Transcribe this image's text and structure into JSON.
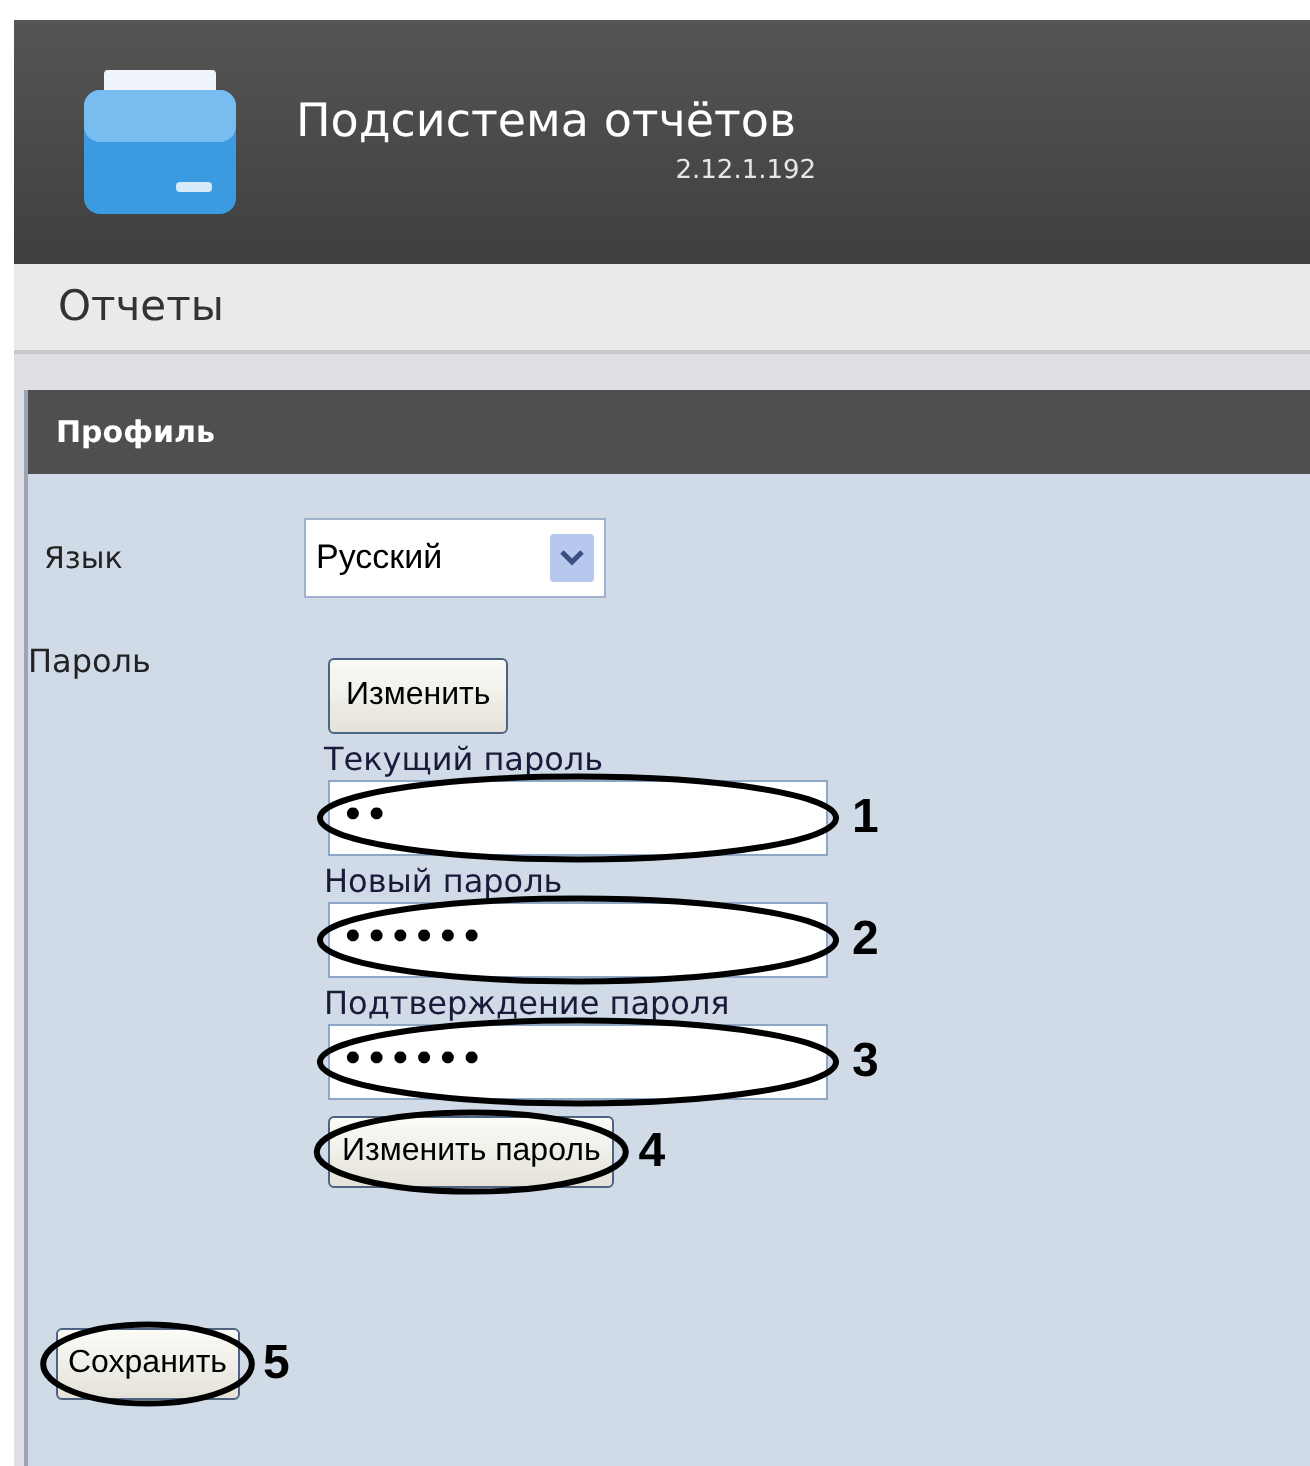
{
  "header": {
    "title": "Подсистема отчётов",
    "version": "2.12.1.192"
  },
  "nav": {
    "label": "Отчеты"
  },
  "panel": {
    "title": "Профиль",
    "language": {
      "label": "Язык",
      "value": "Русский"
    },
    "password": {
      "label": "Пароль",
      "toggle_button": "Изменить",
      "fields": [
        {
          "label": "Текущий пароль",
          "value": "••",
          "callout": "1"
        },
        {
          "label": "Новый пароль",
          "value": "••••••",
          "callout": "2"
        },
        {
          "label": "Подтверждение пароля",
          "value": "••••••",
          "callout": "3"
        }
      ],
      "submit": {
        "label": "Изменить пароль",
        "callout": "4"
      }
    },
    "save": {
      "label": "Сохранить",
      "callout": "5"
    }
  }
}
